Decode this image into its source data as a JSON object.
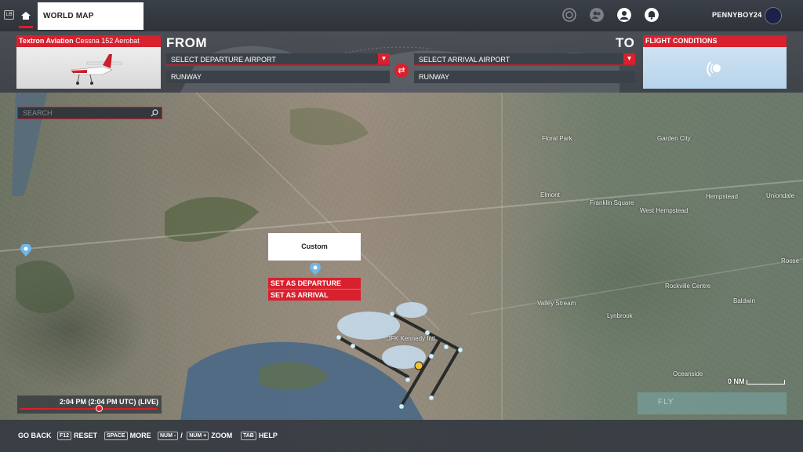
{
  "topbar": {
    "lb_badge": "LB",
    "tab_world_map": "WORLD MAP",
    "username": "PENNYBOY24"
  },
  "planbar": {
    "aircraft_brand": "Textron Aviation",
    "aircraft_model": "Cessna 152 Aerobat",
    "from_label": "FROM",
    "to_label": "TO",
    "departure_placeholder": "SELECT DEPARTURE AIRPORT",
    "arrival_placeholder": "SELECT ARRIVAL AIRPORT",
    "departure_runway": "RUNWAY",
    "arrival_runway": "RUNWAY",
    "conditions_title": "FLIGHT CONDITIONS"
  },
  "map": {
    "search_placeholder": "SEARCH",
    "towns": [
      "Floral Park",
      "Garden City",
      "Elmont",
      "Franklin Square",
      "West Hempstead",
      "Hempstead",
      "Uniondale",
      "Roose",
      "Rockville Centre",
      "Baldwin",
      "Valley Stream",
      "Lynbrook",
      "Oceanside"
    ],
    "airport_label": "JFK Kennedy Intl",
    "popup_title": "Custom",
    "popup_set_departure": "SET AS DEPARTURE",
    "popup_set_arrival": "SET AS ARRIVAL",
    "scale_label": "0 NM",
    "time_text": "2:04 PM (2:04 PM UTC) (LIVE)",
    "time_progress": 0.58,
    "fly_label": "FLY"
  },
  "bottombar": {
    "go_back": "GO BACK",
    "reset_key": "F12",
    "reset": "RESET",
    "more_key": "SPACE",
    "more": "MORE",
    "zoom_key_out": "NUM -",
    "zoom_sep": "/",
    "zoom_key_in": "NUM +",
    "zoom": "ZOOM",
    "help_key": "TAB",
    "help": "HELP"
  },
  "colors": {
    "accent_red": "#d8202e",
    "panel_dark": "#3b4149",
    "water": "#4d6a86"
  },
  "icons": {
    "home": "home-icon",
    "activity": "activity-icon",
    "friends": "friends-icon",
    "profile": "profile-icon",
    "notifications": "bell-icon",
    "search": "search-icon",
    "swap": "swap-icon",
    "pin": "location-pin-icon",
    "airport": "airport-icon"
  }
}
